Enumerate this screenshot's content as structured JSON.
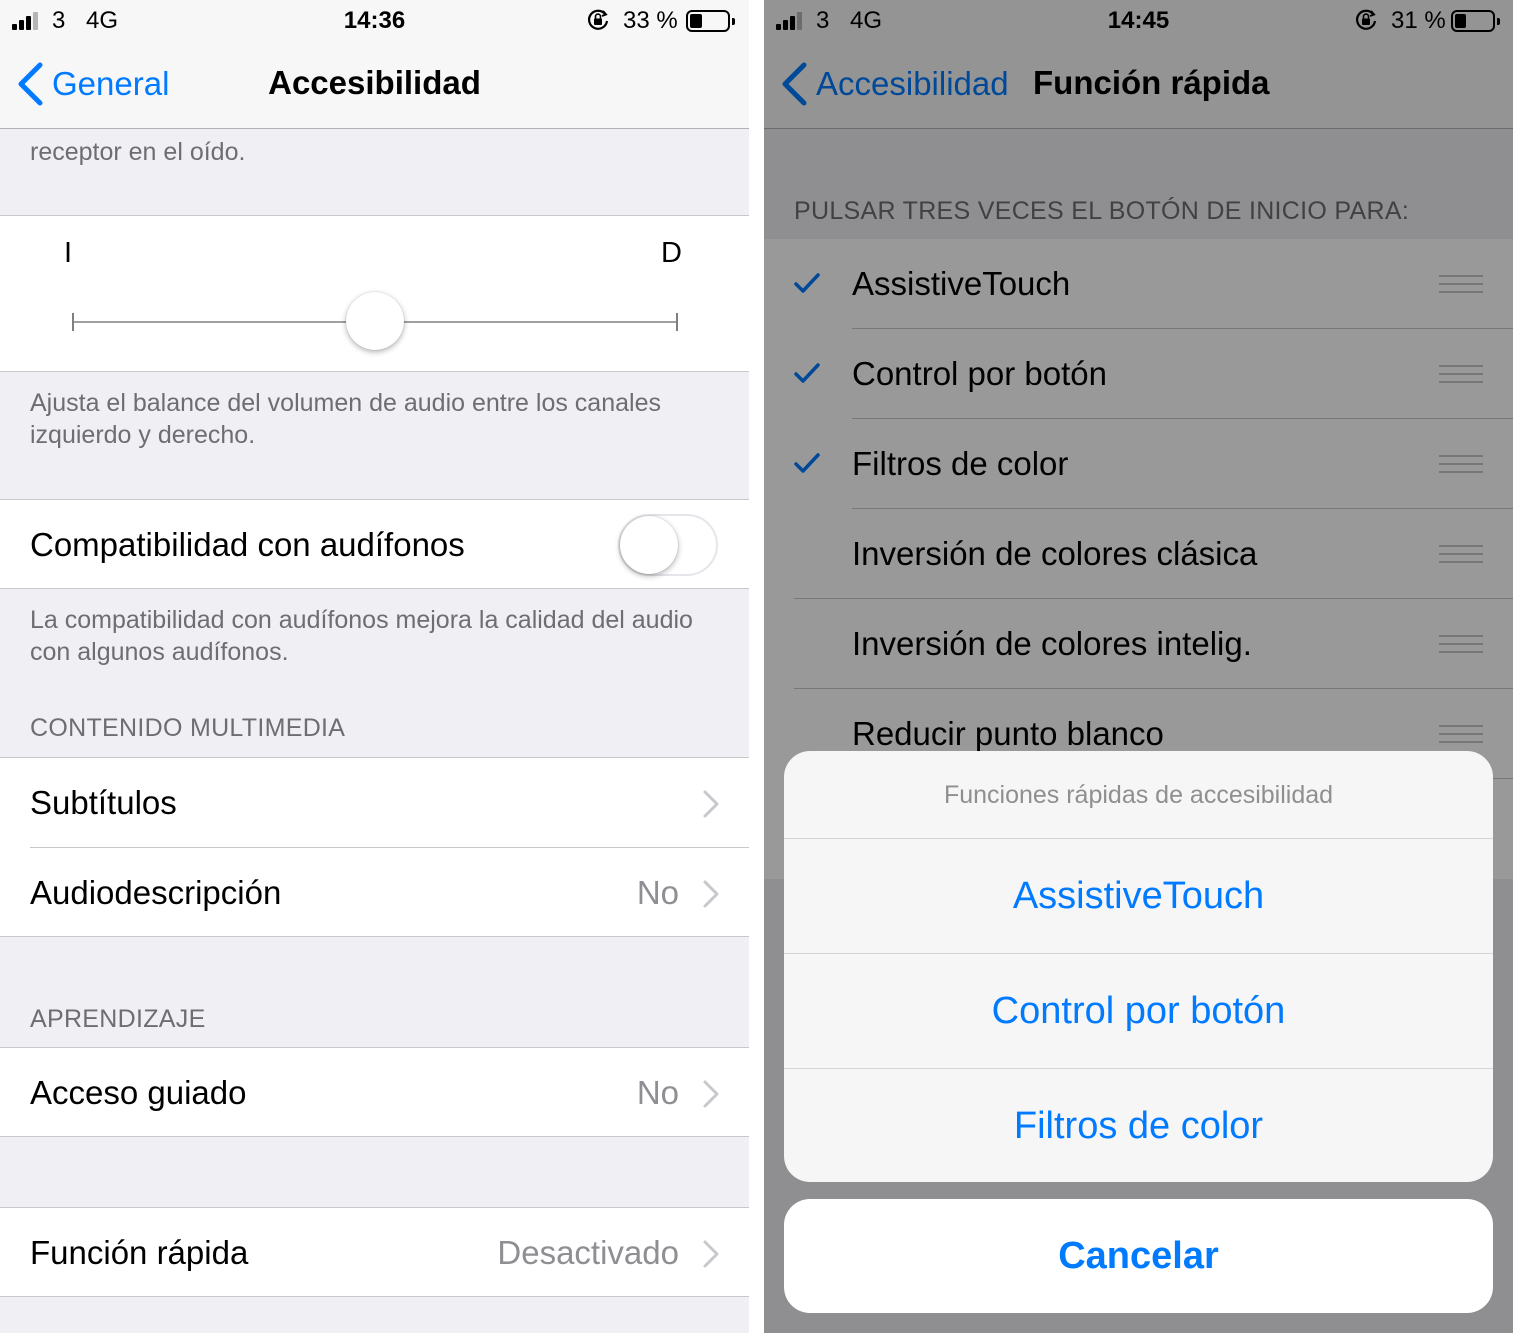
{
  "colors": {
    "accent": "#007aff",
    "secondary_text": "#8e8e93",
    "group_background": "#efeff4",
    "separator": "#c8c7cc"
  },
  "left": {
    "status": {
      "carrier": "3",
      "network": "4G",
      "time": "14:36",
      "battery": "33 %",
      "battery_level": 0.33,
      "signal_bars": 3
    },
    "nav": {
      "back_label": "General",
      "title": "Accesibilidad"
    },
    "top_footer": "receptor en el oído.",
    "balance": {
      "left_letter": "I",
      "right_letter": "D",
      "position": 0.5,
      "footer": "Ajusta el balance del volumen de audio entre los canales izquierdo y derecho."
    },
    "hearing": {
      "label": "Compatibilidad con audífonos",
      "enabled": false,
      "footer": "La compatibilidad con audífonos mejora la calidad del audio con algunos audífonos."
    },
    "media": {
      "header": "CONTENIDO MULTIMEDIA",
      "rows": [
        {
          "label": "Subtítulos",
          "value": ""
        },
        {
          "label": "Audiodescripción",
          "value": "No"
        }
      ]
    },
    "learning": {
      "header": "APRENDIZAJE",
      "rows": [
        {
          "label": "Acceso guiado",
          "value": "No"
        }
      ]
    },
    "shortcut": {
      "label": "Función rápida",
      "value": "Desactivado"
    }
  },
  "right": {
    "status": {
      "carrier": "3",
      "network": "4G",
      "time": "14:45",
      "battery": "31 %",
      "battery_level": 0.31,
      "signal_bars": 3
    },
    "nav": {
      "back_label": "Accesibilidad",
      "title": "Función rápida"
    },
    "section_header": "PULSAR TRES VECES EL BOTÓN DE INICIO PARA:",
    "options": [
      {
        "label": "AssistiveTouch",
        "checked": true
      },
      {
        "label": "Control por botón",
        "checked": true
      },
      {
        "label": "Filtros de color",
        "checked": true
      },
      {
        "label": "Inversión de colores clásica",
        "checked": false
      },
      {
        "label": "Inversión de colores intelig.",
        "checked": false
      },
      {
        "label": "Reducir punto blanco",
        "checked": false
      }
    ],
    "sheet": {
      "title": "Funciones rápidas de accesibilidad",
      "actions": [
        "AssistiveTouch",
        "Control por botón",
        "Filtros de color"
      ],
      "cancel": "Cancelar"
    }
  }
}
